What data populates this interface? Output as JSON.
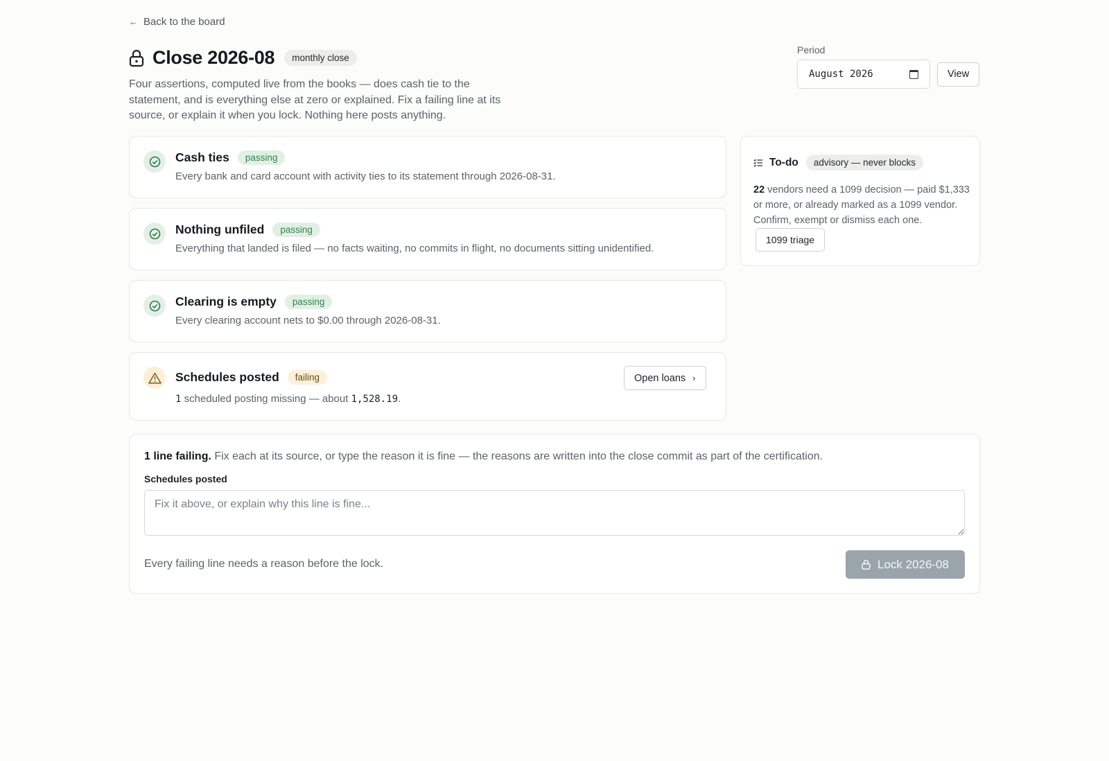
{
  "nav": {
    "back_label": "Back to the board"
  },
  "header": {
    "title": "Close 2026-08",
    "tag": "monthly close",
    "intro": "Four assertions, computed live from the books — does cash tie to the statement, and is everything else at zero or explained. Fix a failing line at its source, or explain it when you lock. Nothing here posts anything."
  },
  "period": {
    "label": "Period",
    "value": "August 2026",
    "view_label": "View"
  },
  "checks": [
    {
      "title": "Cash ties",
      "status": "passing",
      "desc": "Every bank and card account with activity ties to its statement through 2026-08-31."
    },
    {
      "title": "Nothing unfiled",
      "status": "passing",
      "desc": "Everything that landed is filed — no facts waiting, no commits in flight, no documents sitting unidentified."
    },
    {
      "title": "Clearing is empty",
      "status": "passing",
      "desc": "Every clearing account nets to $0.00 through 2026-08-31."
    },
    {
      "title": "Schedules posted",
      "status": "failing",
      "count": "1",
      "desc_mid": " scheduled posting missing — about ",
      "amount": "1,528.19",
      "desc_end": ".",
      "action_label": "Open loans"
    }
  ],
  "todo": {
    "title": "To-do",
    "badge": "advisory — never blocks",
    "count": "22",
    "text": " vendors need a 1099 decision — paid $1,333 or more, or already marked as a 1099 vendor. Confirm, exempt or dismiss each one. ",
    "action_label": "1099 triage"
  },
  "lock": {
    "summary_bold": "1 line failing.",
    "summary_rest": " Fix each at its source, or type the reason it is fine — the reasons are written into the close commit as part of the certification.",
    "field_label": "Schedules posted",
    "placeholder": "Fix it above, or explain why this line is fine...",
    "hint": "Every failing line needs a reason before the lock.",
    "button_label": "Lock 2026-08"
  },
  "colors": {
    "passing": "#2b8a49",
    "failing": "#b7791f",
    "lock_disabled": "#9aa4ab"
  }
}
